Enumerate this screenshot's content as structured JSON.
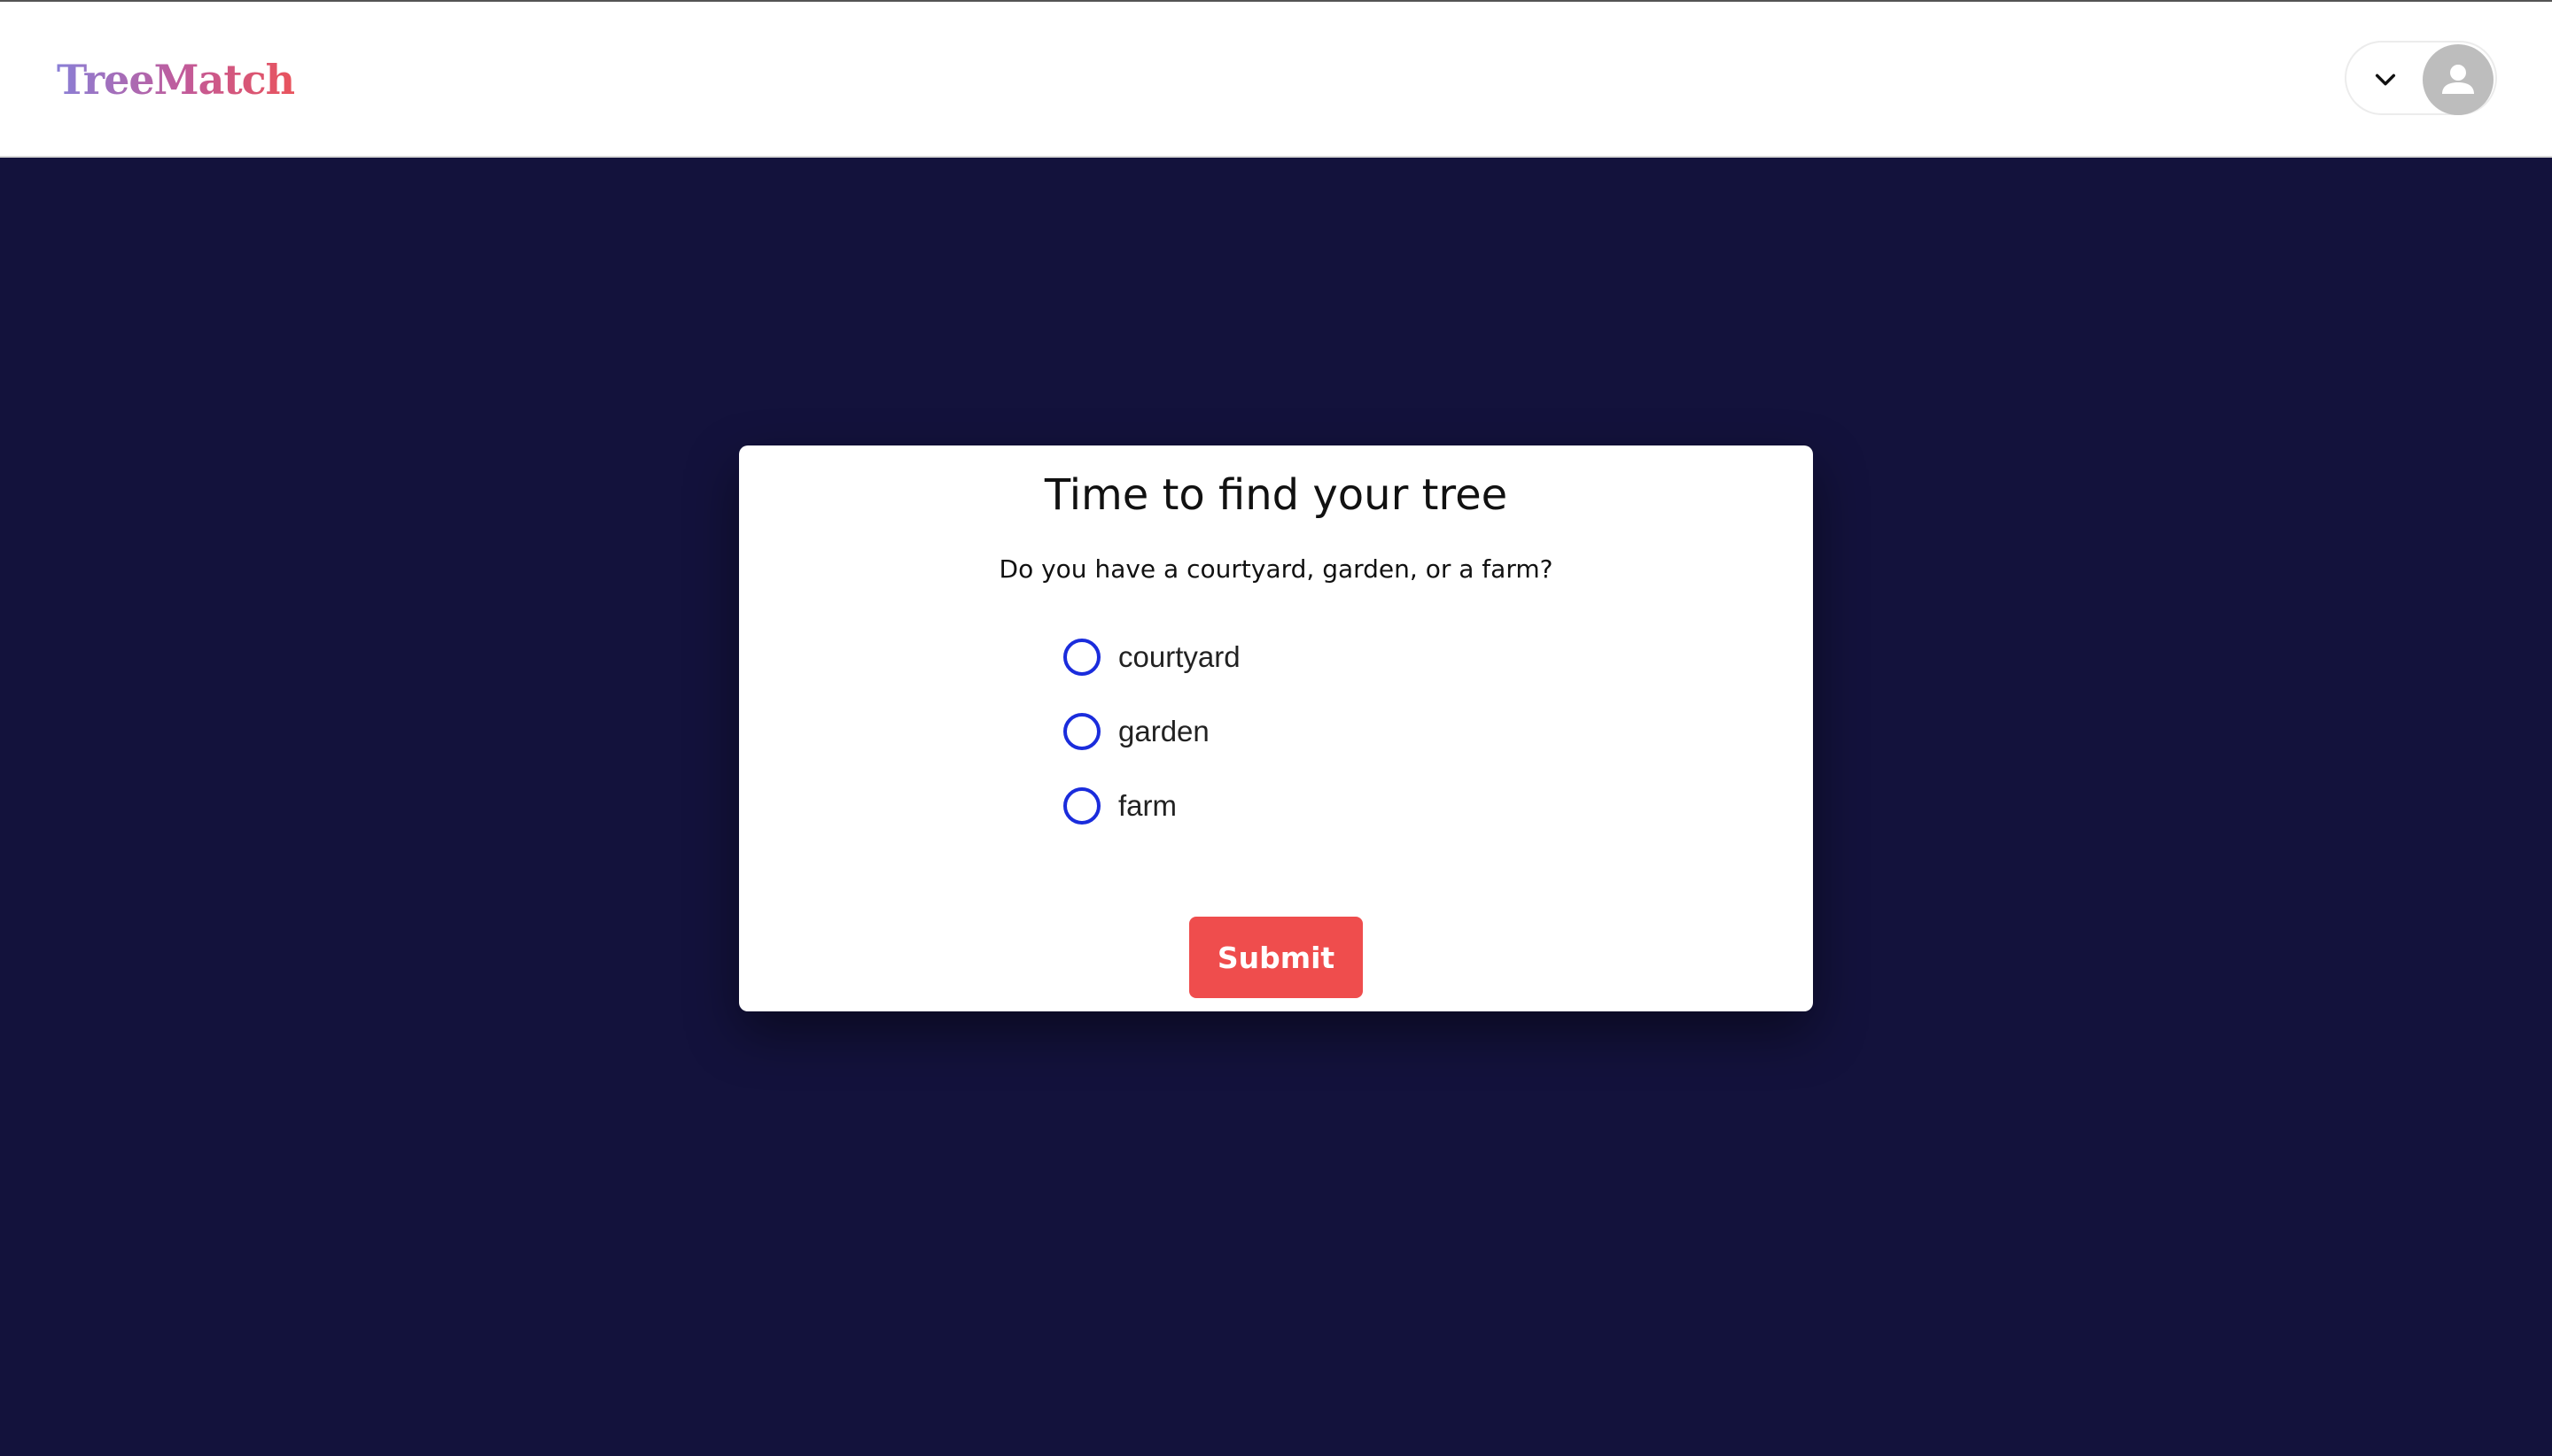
{
  "header": {
    "logo_text": "TreeMatch",
    "user_menu": {
      "dropdown_icon": "chevron-down-icon",
      "avatar_icon": "user-avatar-icon"
    }
  },
  "quiz": {
    "title": "Time to find your tree",
    "question": "Do you have a courtyard, garden, or a farm?",
    "options": [
      {
        "label": "courtyard",
        "selected": false
      },
      {
        "label": "garden",
        "selected": false
      },
      {
        "label": "farm",
        "selected": false
      }
    ],
    "submit_label": "Submit"
  },
  "colors": {
    "background": "#13123c",
    "accent_button": "#ef4d4d",
    "radio_border": "#1a2cdc",
    "logo_gradient_start": "#8a7fd6",
    "logo_gradient_end": "#e9535c"
  }
}
